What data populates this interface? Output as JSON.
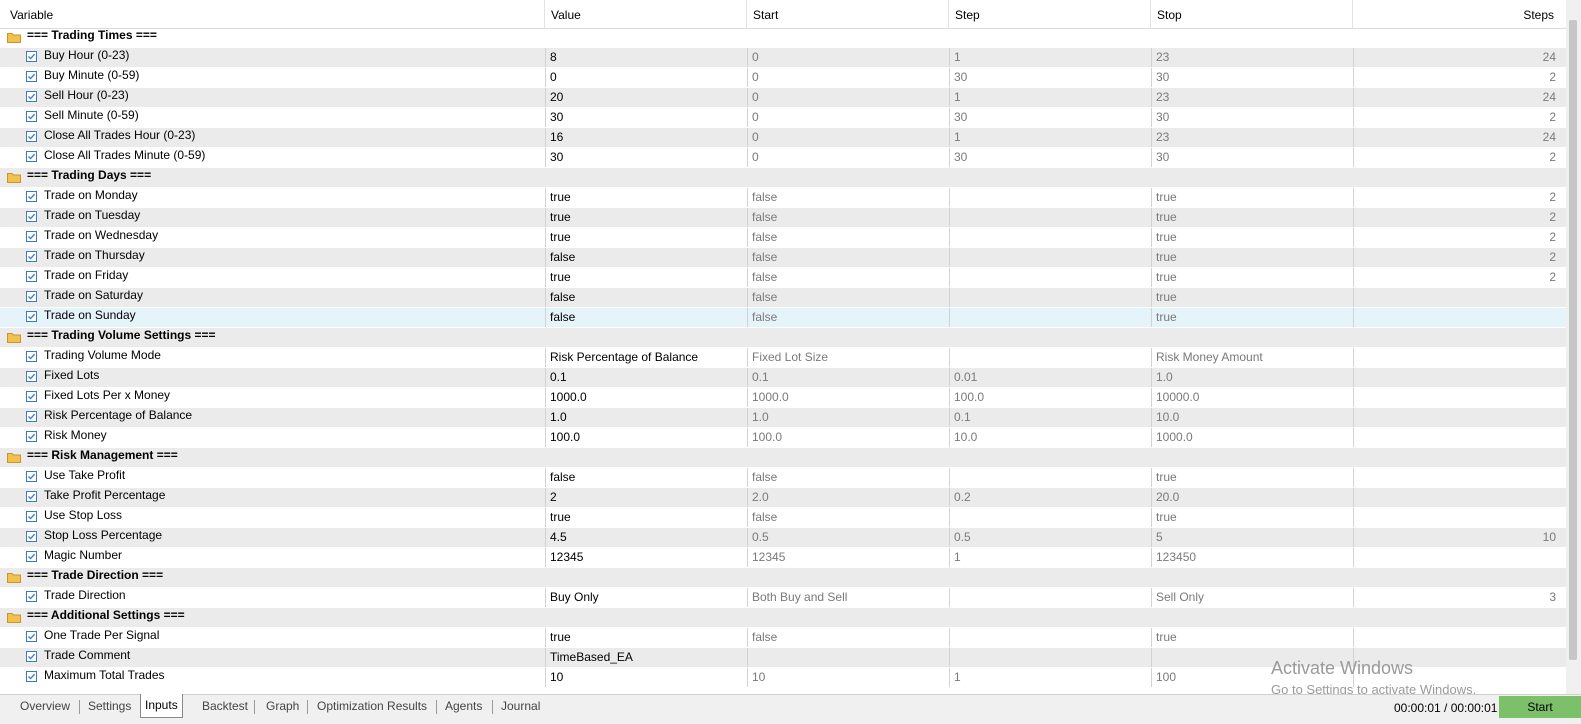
{
  "columns": [
    "Variable",
    "Value",
    "Start",
    "Step",
    "Stop",
    "Steps"
  ],
  "rows": [
    {
      "type": "group",
      "name": "=== Trading Times ==="
    },
    {
      "type": "param",
      "name": "Buy Hour (0-23)",
      "value": "8",
      "start": "0",
      "step": "1",
      "stop": "23",
      "steps": "24"
    },
    {
      "type": "param",
      "name": "Buy Minute (0-59)",
      "value": "0",
      "start": "0",
      "step": "30",
      "stop": "30",
      "steps": "2"
    },
    {
      "type": "param",
      "name": "Sell Hour (0-23)",
      "value": "20",
      "start": "0",
      "step": "1",
      "stop": "23",
      "steps": "24"
    },
    {
      "type": "param",
      "name": "Sell Minute (0-59)",
      "value": "30",
      "start": "0",
      "step": "30",
      "stop": "30",
      "steps": "2"
    },
    {
      "type": "param",
      "name": "Close All Trades Hour (0-23)",
      "value": "16",
      "start": "0",
      "step": "1",
      "stop": "23",
      "steps": "24"
    },
    {
      "type": "param",
      "name": "Close All Trades Minute (0-59)",
      "value": "30",
      "start": "0",
      "step": "30",
      "stop": "30",
      "steps": "2"
    },
    {
      "type": "group",
      "name": "=== Trading Days ==="
    },
    {
      "type": "param",
      "name": "Trade on Monday",
      "value": "true",
      "start": "false",
      "step": "",
      "stop": "true",
      "steps": "2"
    },
    {
      "type": "param",
      "name": "Trade on Tuesday",
      "value": "true",
      "start": "false",
      "step": "",
      "stop": "true",
      "steps": "2"
    },
    {
      "type": "param",
      "name": "Trade on Wednesday",
      "value": "true",
      "start": "false",
      "step": "",
      "stop": "true",
      "steps": "2"
    },
    {
      "type": "param",
      "name": "Trade on Thursday",
      "value": "false",
      "start": "false",
      "step": "",
      "stop": "true",
      "steps": "2"
    },
    {
      "type": "param",
      "name": "Trade on Friday",
      "value": "true",
      "start": "false",
      "step": "",
      "stop": "true",
      "steps": "2"
    },
    {
      "type": "param",
      "name": "Trade on Saturday",
      "value": "false",
      "start": "false",
      "step": "",
      "stop": "true",
      "steps": ""
    },
    {
      "type": "param",
      "name": "Trade on Sunday",
      "value": "false",
      "start": "false",
      "step": "",
      "stop": "true",
      "steps": "",
      "selected": true
    },
    {
      "type": "group",
      "name": "=== Trading Volume Settings ==="
    },
    {
      "type": "param",
      "name": "Trading Volume Mode",
      "value": "Risk Percentage of Balance",
      "start": "Fixed Lot Size",
      "step": "",
      "stop": "Risk Money Amount",
      "steps": ""
    },
    {
      "type": "param",
      "name": "Fixed Lots",
      "value": "0.1",
      "start": "0.1",
      "step": "0.01",
      "stop": "1.0",
      "steps": ""
    },
    {
      "type": "param",
      "name": "Fixed Lots Per x Money",
      "value": "1000.0",
      "start": "1000.0",
      "step": "100.0",
      "stop": "10000.0",
      "steps": ""
    },
    {
      "type": "param",
      "name": "Risk Percentage of Balance",
      "value": "1.0",
      "start": "1.0",
      "step": "0.1",
      "stop": "10.0",
      "steps": ""
    },
    {
      "type": "param",
      "name": "Risk Money",
      "value": "100.0",
      "start": "100.0",
      "step": "10.0",
      "stop": "1000.0",
      "steps": ""
    },
    {
      "type": "group",
      "name": "=== Risk Management ==="
    },
    {
      "type": "param",
      "name": "Use Take Profit",
      "value": "false",
      "start": "false",
      "step": "",
      "stop": "true",
      "steps": ""
    },
    {
      "type": "param",
      "name": "Take Profit Percentage",
      "value": "2",
      "start": "2.0",
      "step": "0.2",
      "stop": "20.0",
      "steps": ""
    },
    {
      "type": "param",
      "name": "Use Stop Loss",
      "value": "true",
      "start": "false",
      "step": "",
      "stop": "true",
      "steps": ""
    },
    {
      "type": "param",
      "name": "Stop Loss Percentage",
      "value": "4.5",
      "start": "0.5",
      "step": "0.5",
      "stop": "5",
      "steps": "10"
    },
    {
      "type": "param",
      "name": "Magic Number",
      "value": "12345",
      "start": "12345",
      "step": "1",
      "stop": "123450",
      "steps": ""
    },
    {
      "type": "group",
      "name": "=== Trade Direction ==="
    },
    {
      "type": "param",
      "name": "Trade Direction",
      "value": "Buy Only",
      "start": "Both Buy and Sell",
      "step": "",
      "stop": "Sell Only",
      "steps": "3"
    },
    {
      "type": "group",
      "name": "=== Additional Settings ==="
    },
    {
      "type": "param",
      "name": "One Trade Per Signal",
      "value": "true",
      "start": "false",
      "step": "",
      "stop": "true",
      "steps": ""
    },
    {
      "type": "param",
      "name": "Trade Comment",
      "value": "TimeBased_EA",
      "start": "",
      "step": "",
      "stop": "",
      "steps": ""
    },
    {
      "type": "param",
      "name": "Maximum Total Trades",
      "value": "10",
      "start": "10",
      "step": "1",
      "stop": "100",
      "steps": ""
    }
  ],
  "tabs": [
    "Overview",
    "Settings",
    "Inputs",
    "Backtest",
    "Graph",
    "Optimization Results",
    "Agents",
    "Journal"
  ],
  "active_tab": "Inputs",
  "timer": "00:00:01 / 00:00:01",
  "start_button": "Start",
  "watermark": {
    "line1": "Activate Windows",
    "line2": "Go to Settings to activate Windows."
  },
  "icons": {
    "group": "folder-icon",
    "param": "checkbox-checked-icon"
  },
  "colors": {
    "alt_row": "#ebebeb",
    "selected_row": "#e5f3fb",
    "start_button": "#7cc16a",
    "folder": "#f2c14e",
    "checkbox": "#3c78c8"
  }
}
